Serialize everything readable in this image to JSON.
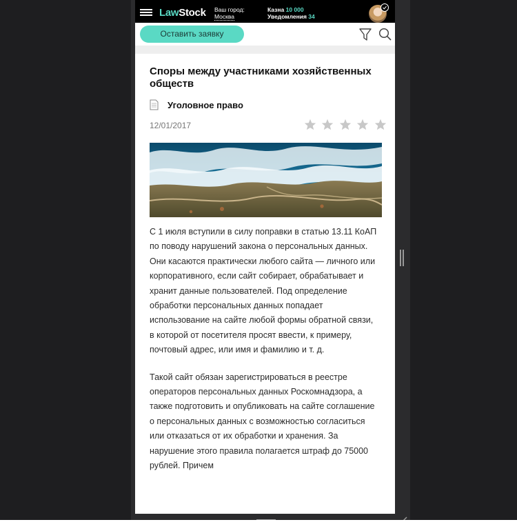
{
  "header": {
    "logo_law": "Law",
    "logo_stock": "Stock",
    "city_label": "Ваш город:",
    "city_value": "Москва",
    "treasury_label": "Казна",
    "treasury_value": "10 000",
    "notifications_label": "Уведомления",
    "notifications_value": "34",
    "menu_icon": "hamburger-icon",
    "avatar_icon": "user-avatar"
  },
  "toolbar": {
    "request_label": "Оставить заявку",
    "filter_icon": "filter-icon",
    "search_icon": "search-icon"
  },
  "article": {
    "title": "Споры между участниками хозяйственных обществ",
    "category": "Уголовное право",
    "date": "12/01/2017",
    "rating_max": 5,
    "rating_filled": 0,
    "paragraphs": [
      "С 1 июля вступили в силу поправки в статью 13.11 КоАП по поводу нарушений закона о персональных данных. Они касаются практически любого сайта — личного или корпоративного, если сайт собирает, обрабатывает и хранит данные пользователей. Под определение обработки персональных данных попадает использование на сайте любой формы обратной связи, в которой от посетителя просят ввести, к примеру, почтовый адрес, или имя и фамилию и т. д.",
      "Такой сайт обязан зарегистрироваться в реестре операторов персональных данных Роскомнадзора, а также подготовить и опубликовать на сайте соглашение о персональных данных с возможностью согласиться или отказаться от их обработки и хранения. За нарушение этого правила полагается штраф до 75000 рублей. Причем"
    ]
  },
  "colors": {
    "accent": "#5ad9c4",
    "header_bg": "#000000",
    "star": "#c8c8c8"
  }
}
